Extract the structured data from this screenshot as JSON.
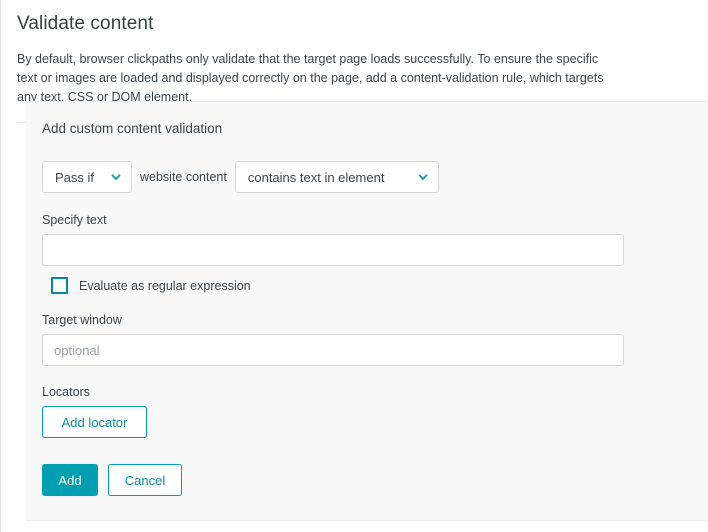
{
  "header": {
    "title": "Validate content",
    "description": "By default, browser clickpaths only validate that the target page loads successfully. To ensure the specific text or images are loaded and displayed correctly on the page, add a content-validation rule, which targets any text, CSS or DOM element."
  },
  "card": {
    "title": "Add custom content validation",
    "rule": {
      "pass_condition": "Pass if",
      "middle_label": "website content",
      "match_condition": "contains text in element"
    },
    "specify_text": {
      "label": "Specify text",
      "value": "",
      "placeholder": ""
    },
    "regex_checkbox": {
      "label": "Evaluate as regular expression",
      "checked": false
    },
    "target_window": {
      "label": "Target window",
      "value": "",
      "placeholder": "optional"
    },
    "locators": {
      "label": "Locators",
      "add_button": "Add locator"
    },
    "actions": {
      "add": "Add",
      "cancel": "Cancel"
    }
  },
  "colors": {
    "accent": "#00a0b0",
    "accent_dark": "#008b9a",
    "text": "#3c444b",
    "panel_bg": "#f8f8f8",
    "border": "#d6d6d6"
  },
  "icons": {
    "chevron_down": "chevron-down-icon"
  }
}
